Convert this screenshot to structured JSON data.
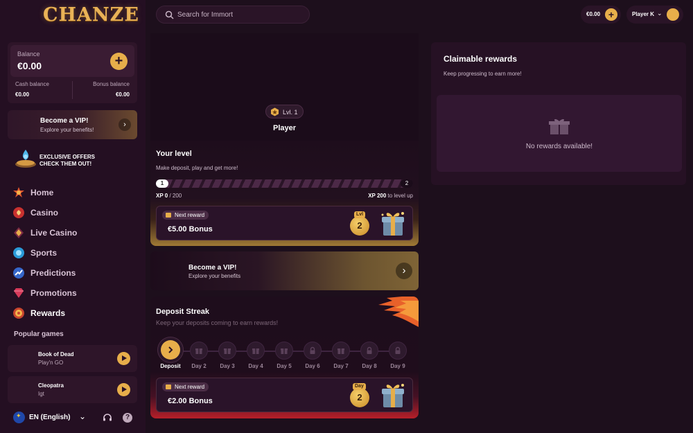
{
  "brand": {
    "logo_text": "CHANZE",
    "accent": "#e7ae4a"
  },
  "header": {
    "search_placeholder": "Search for Immort",
    "wallet_amount": "€0.00",
    "user_name": "Player K"
  },
  "sidebar": {
    "balance": {
      "label": "Balance",
      "value": "€0.00",
      "cash_label": "Cash balance",
      "cash_value": "€0.00",
      "bonus_label": "Bonus balance",
      "bonus_value": "€0.00"
    },
    "vip": {
      "title": "Become a VIP!",
      "subtitle": "Explore your benefits!"
    },
    "exclusive": {
      "line1": "EXCLUSIVE OFFERS",
      "line2": "CHECK THEM OUT!"
    },
    "nav": [
      {
        "label": "Home",
        "icon": "home-icon"
      },
      {
        "label": "Casino",
        "icon": "casino-icon"
      },
      {
        "label": "Live Casino",
        "icon": "live-casino-icon"
      },
      {
        "label": "Sports",
        "icon": "sports-icon"
      },
      {
        "label": "Predictions",
        "icon": "predictions-icon"
      },
      {
        "label": "Promotions",
        "icon": "promotions-icon"
      },
      {
        "label": "Rewards",
        "icon": "rewards-icon",
        "active": true
      }
    ],
    "popular_title": "Popular games",
    "games": [
      {
        "title": "Book of Dead",
        "provider": "Play'n GO"
      },
      {
        "title": "Cleopatra",
        "provider": "Igt"
      }
    ],
    "language": "EN (English)"
  },
  "player": {
    "level_label": "Lvl. 1",
    "name": "Player"
  },
  "level": {
    "title": "Your level",
    "subtitle": "Make deposit, play and get more!",
    "current_level": "1",
    "next_level": "2",
    "xp_current": "XP 0",
    "xp_total": "/ 200",
    "xp_needed": "XP 200",
    "xp_needed_suffix": "to level up",
    "progress": 0,
    "next_reward_label": "Next reward",
    "reward_amount": "€5.00 Bonus",
    "reward_tag": "Lvl",
    "reward_number": "2"
  },
  "vip_banner": {
    "title": "Become a VIP!",
    "subtitle": "Explore your benefits"
  },
  "streak": {
    "title": "Deposit Streak",
    "subtitle": "Keep your deposits coming to earn rewards!",
    "days": [
      {
        "label": "Deposit",
        "icon": "arrow-icon",
        "current": true
      },
      {
        "label": "Day 2",
        "icon": "gift-icon"
      },
      {
        "label": "Day 3",
        "icon": "gift-icon"
      },
      {
        "label": "Day 4",
        "icon": "gift-icon"
      },
      {
        "label": "Day 5",
        "icon": "gift-icon"
      },
      {
        "label": "Day 6",
        "icon": "lock-icon"
      },
      {
        "label": "Day 7",
        "icon": "gift-icon"
      },
      {
        "label": "Day 8",
        "icon": "lock-icon"
      },
      {
        "label": "Day 9",
        "icon": "lock-icon"
      }
    ],
    "next_reward_label": "Next reward",
    "reward_amount": "€2.00 Bonus",
    "reward_tag": "Day",
    "reward_number": "2"
  },
  "claimable": {
    "title": "Claimable rewards",
    "subtitle": "Keep progressing to earn more!",
    "empty_text": "No rewards available!"
  }
}
